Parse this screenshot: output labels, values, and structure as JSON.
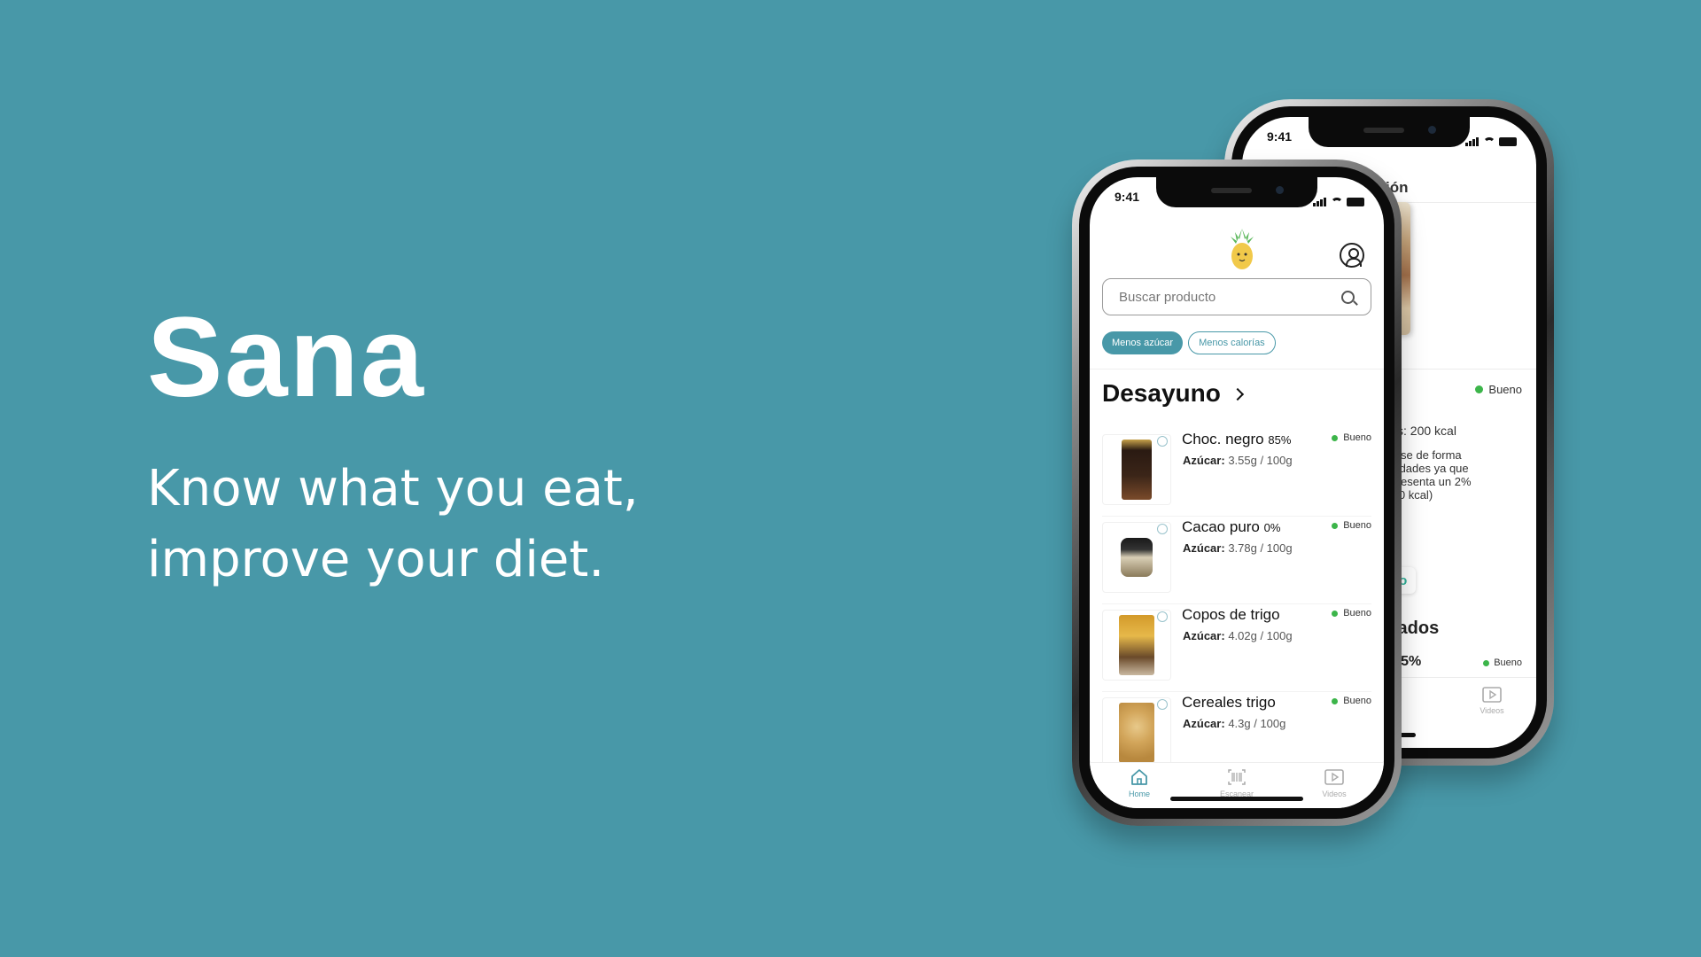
{
  "hero": {
    "title": "Sana",
    "subtitle_line1": "Know what you eat,",
    "subtitle_line2": "improve your diet."
  },
  "colors": {
    "background": "#4898a8",
    "accent": "#4898a8",
    "good": "#3cb54a"
  },
  "front_phone": {
    "status_time": "9:41",
    "search": {
      "placeholder": "Buscar producto"
    },
    "filters": [
      "Menos azúcar",
      "Menos calorías"
    ],
    "active_filter": "Menos azúcar",
    "section_title": "Desayuno",
    "products": [
      {
        "name": "Choc. negro",
        "pct": "85%",
        "sugar_label": "Azúcar:",
        "sugar": "3.55g / 100g",
        "rating": "Bueno"
      },
      {
        "name": "Cacao puro",
        "pct": "0%",
        "sugar_label": "Azúcar:",
        "sugar": "3.78g / 100g",
        "rating": "Bueno"
      },
      {
        "name": "Copos de trigo",
        "pct": "",
        "sugar_label": "Azúcar:",
        "sugar": "4.02g / 100g",
        "rating": "Bueno"
      },
      {
        "name": "Cereales trigo",
        "pct": "",
        "sugar_label": "Azúcar:",
        "sugar": "4.3g / 100g",
        "rating": "Bueno"
      }
    ],
    "tabs": [
      {
        "label": "Home",
        "icon": "home-icon"
      },
      {
        "label": "Escanear",
        "icon": "barcode-icon"
      },
      {
        "label": "Videos",
        "icon": "video-icon"
      }
    ]
  },
  "back_phone": {
    "status_time": "9:41",
    "header_fragment": "mación",
    "name_fragment": "e",
    "rating": "Bueno",
    "calories": "alorías: 200 kcal",
    "description": "asumirse de forma\ns cantidades ya que\nr. Representa un 2%\no (2000 kcal)\ndia.",
    "delivery": "Glovo",
    "recommended_fragment": "endados",
    "item_fragment": "gro 95%",
    "item_rating": "Bueno",
    "tab_left_fragment": "ar",
    "tab_right": "Videos"
  }
}
